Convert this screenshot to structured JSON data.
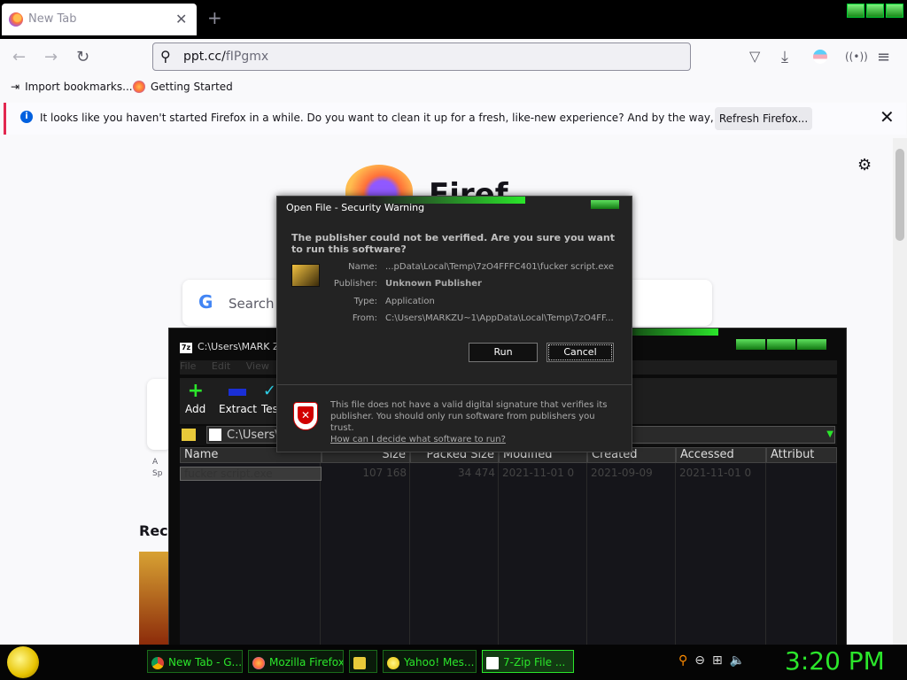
{
  "browser": {
    "tab": {
      "title": "New Tab",
      "close": "✕"
    },
    "new_tab": "+",
    "url": {
      "host": "ppt.cc/",
      "path": "fIPgmx"
    },
    "bookmarks": [
      {
        "label": "Import bookmarks..."
      },
      {
        "label": "Getting Started"
      }
    ],
    "infobar": {
      "message": "It looks like you haven't started Firefox in a while. Do you want to clean it up for a fresh, like-new experience? And by the way, welcome back!",
      "button": "Refresh Firefox...",
      "close": "✕"
    },
    "newtab": {
      "brand": "Firef",
      "search_placeholder": "Search w",
      "google": "G",
      "recent_heading": "Reco",
      "shortcut_label_1": "A",
      "shortcut_label_2": "Sp"
    }
  },
  "zip": {
    "title": "C:\\Users\\MARK Z",
    "menu": [
      "File",
      "Edit",
      "View"
    ],
    "toolbar": [
      {
        "label": "Add",
        "icon": "plus-icon"
      },
      {
        "label": "Extract",
        "icon": "minus-icon"
      },
      {
        "label": "Tes",
        "icon": "check-icon"
      }
    ],
    "address": "C:\\Users\\",
    "columns": [
      "Name",
      "Size",
      "Packed Size",
      "Modified",
      "Created",
      "Accessed",
      "Attribut"
    ],
    "rows": [
      {
        "name": "fucker script.exe",
        "size": "107 168",
        "packed": "34 474",
        "modified": "2021-11-01 0",
        "created": "2021-09-09",
        "accessed": "2021-11-01 0"
      }
    ]
  },
  "dialog": {
    "title": "Open File - Security Warning",
    "heading": "The publisher could not be verified.  Are you sure you want to run this software?",
    "fields": {
      "name_label": "Name:",
      "name": "...pData\\Local\\Temp\\7zO4FFFC401\\fucker script.exe",
      "publisher_label": "Publisher:",
      "publisher": "Unknown Publisher",
      "type_label": "Type:",
      "type": "Application",
      "from_label": "From:",
      "from": "C:\\Users\\MARKZU~1\\AppData\\Local\\Temp\\7zO4FF..."
    },
    "run": "Run",
    "cancel": "Cancel",
    "warning": "This file does not have a valid digital signature that verifies its publisher.  You should only run software from publishers you trust.",
    "link": "How can I decide what software to run?"
  },
  "taskbar": {
    "items": [
      {
        "label": "New Tab - G...",
        "icon": "chrome-icon"
      },
      {
        "label": "Mozilla Firefox",
        "icon": "firefox-icon"
      },
      {
        "label": "",
        "icon": "folder-icon"
      },
      {
        "label": "Yahoo! Mes...",
        "icon": "yahoo-icon"
      },
      {
        "label": "7-Zip File ...",
        "icon": "7zip-icon"
      }
    ],
    "clock": "3:20 PM"
  },
  "colors": {
    "accent_green": "#2be62b",
    "firefox_red": "#e22850"
  }
}
